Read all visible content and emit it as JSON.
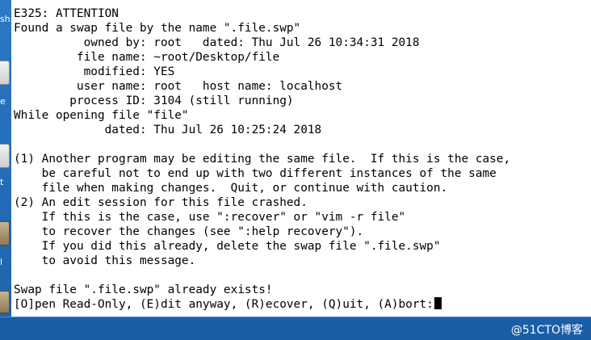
{
  "desktop": {
    "labels": [
      "sh",
      "e",
      "t",
      "l"
    ]
  },
  "terminal": {
    "lines": [
      "E325: ATTENTION",
      "Found a swap file by the name \".file.swp\"",
      "          owned by: root   dated: Thu Jul 26 10:34:31 2018",
      "         file name: ~root/Desktop/file",
      "          modified: YES",
      "         user name: root   host name: localhost",
      "        process ID: 3104 (still running)",
      "While opening file \"file\"",
      "             dated: Thu Jul 26 10:25:24 2018",
      "",
      "(1) Another program may be editing the same file.  If this is the case,",
      "    be careful not to end up with two different instances of the same",
      "    file when making changes.  Quit, or continue with caution.",
      "(2) An edit session for this file crashed.",
      "    If this is the case, use \":recover\" or \"vim -r file\"",
      "    to recover the changes (see \":help recovery\").",
      "    If you did this already, delete the swap file \".file.swp\"",
      "    to avoid this message.",
      "",
      "Swap file \".file.swp\" already exists!"
    ],
    "prompt": "[O]pen Read-Only, (E)dit anyway, (R)ecover, (Q)uit, (A)bort:"
  },
  "watermark": "@51CTO博客"
}
